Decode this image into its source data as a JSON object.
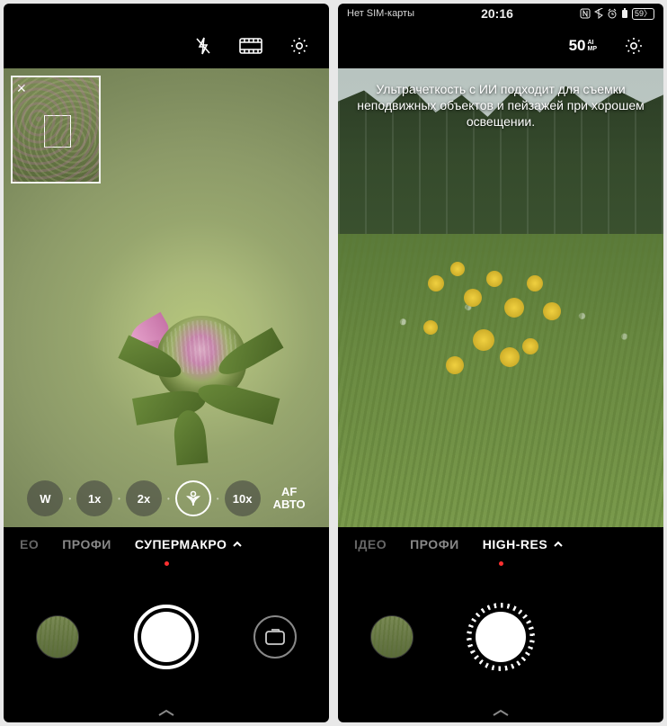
{
  "left": {
    "zoom": {
      "w": "W",
      "x1": "1x",
      "x2": "2x",
      "x10": "10x",
      "af_line1": "AF",
      "af_line2": "АВТО"
    },
    "modes": {
      "video_cut": "ЕО",
      "pro": "ПРОФИ",
      "active": "СУПЕРМАКРО"
    }
  },
  "right": {
    "status": {
      "sim": "Нет SIM-карты",
      "time": "20:16",
      "battery": "59"
    },
    "top": {
      "fifty": "50",
      "fifty_sup1": "AI",
      "fifty_sup2": "MP"
    },
    "tip": "Ультрачеткость с ИИ подходит для съемки неподвижных объектов и пейзажей при хорошем освещении.",
    "modes": {
      "video_cut": "ІДЕО",
      "pro": "ПРОФИ",
      "active": "HIGH-RES"
    }
  }
}
